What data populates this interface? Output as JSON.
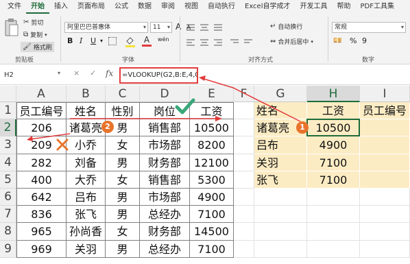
{
  "menu": {
    "tabs": [
      "文件",
      "开始",
      "插入",
      "页面布局",
      "公式",
      "数据",
      "审阅",
      "视图",
      "自动执行",
      "Excel自学成才",
      "开发工具",
      "帮助",
      "PDF工具集"
    ],
    "active": "开始"
  },
  "ribbon": {
    "clipboard": {
      "cut": "剪切",
      "copy": "复制",
      "format_painter": "格式刷",
      "label": "剪贴板"
    },
    "font": {
      "name": "阿里巴巴普惠体",
      "size": "11",
      "grow": "A",
      "shrink": "A",
      "bold": "B",
      "italic": "I",
      "underline": "U",
      "wen": "wén",
      "color_a": "A",
      "label": "字体"
    },
    "align": {
      "wrap": "自动换行",
      "merge": "合并后居中",
      "label": "对齐方式"
    },
    "number": {
      "format": "常规",
      "percent": "%",
      "thousands": "9",
      "label": "数字"
    }
  },
  "formula_bar": {
    "name_box": "H2",
    "cancel": "×",
    "enter": "✓",
    "fx": "fx",
    "formula": "=VLOOKUP(G2,B:E,4,0)"
  },
  "columns": [
    "A",
    "B",
    "C",
    "D",
    "E",
    "F",
    "G",
    "H",
    "I"
  ],
  "selected_column": "H",
  "rows": [
    "1",
    "2",
    "3",
    "4",
    "5",
    "6",
    "7",
    "8",
    "9"
  ],
  "selected_row": "2",
  "table": {
    "headers": [
      "员工编号",
      "姓名",
      "性别",
      "岗位",
      "工资"
    ],
    "rows": [
      [
        "206",
        "诸葛亮",
        "男",
        "销售部",
        "10500"
      ],
      [
        "209",
        "小乔",
        "女",
        "市场部",
        "8200"
      ],
      [
        "282",
        "刘备",
        "男",
        "财务部",
        "12100"
      ],
      [
        "400",
        "大乔",
        "女",
        "销售部",
        "5300"
      ],
      [
        "642",
        "吕布",
        "男",
        "市场部",
        "4900"
      ],
      [
        "836",
        "张飞",
        "男",
        "总经办",
        "7100"
      ],
      [
        "965",
        "孙尚香",
        "女",
        "财务部",
        "14500"
      ],
      [
        "969",
        "关羽",
        "男",
        "总经办",
        "7100"
      ]
    ]
  },
  "lookup": {
    "headers": [
      "姓名",
      "工资",
      "员工编号"
    ],
    "rows": [
      [
        "诸葛亮",
        "10500",
        ""
      ],
      [
        "吕布",
        "4900",
        ""
      ],
      [
        "关羽",
        "7100",
        ""
      ],
      [
        "张飞",
        "7100",
        ""
      ]
    ]
  },
  "annotations": {
    "badge1": "1",
    "badge2": "2",
    "accent_red": "#e23c3c",
    "accent_orange": "#e8742c",
    "check_green": "#3aa67a"
  }
}
